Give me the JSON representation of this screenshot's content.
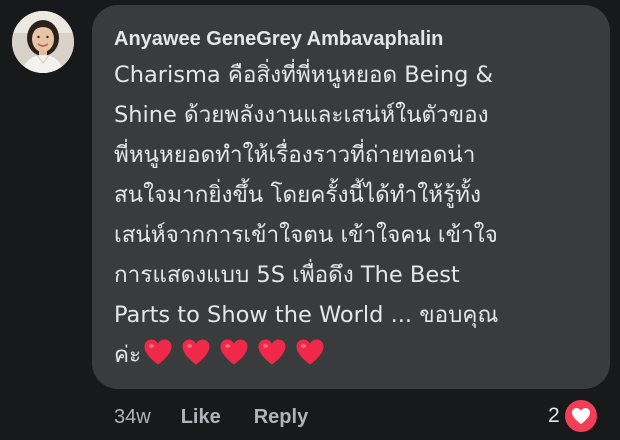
{
  "comment": {
    "author": "Anyawee GeneGrey Ambavaphalin",
    "lines": [
      "Charisma คือสิ่งที่พี่หนูหยอด Being &",
      "Shine ด้วยพลังงานและเสน่ห์ในตัวของ",
      "พี่หนูหยอดทำให้เรื่องราวที่ถ่ายทอดน่า",
      "สนใจมากยิ่งขึ้น โดยครั้งนี้ได้ทำให้รู้ทั้ง",
      "เสน่ห์จากการเข้าใจตน เข้าใจคน เข้าใจ",
      "การแสดงแบบ 5S เพื่อดึง The Best",
      "Parts to Show the World ... ขอบคุณ",
      "ค่ะ"
    ],
    "heart_count": 5,
    "heart_icon": "red-heart-emoji",
    "heart_color": "#f02849"
  },
  "actions": {
    "time": "34w",
    "like_label": "Like",
    "reply_label": "Reply"
  },
  "reactions": {
    "count": "2",
    "icon": "love-reaction-icon",
    "color": "#f33e58"
  },
  "colors": {
    "background": "#18191a",
    "bubble": "#3a3b3c",
    "text": "#e4e6eb",
    "secondary_text": "#b0b3b8"
  }
}
